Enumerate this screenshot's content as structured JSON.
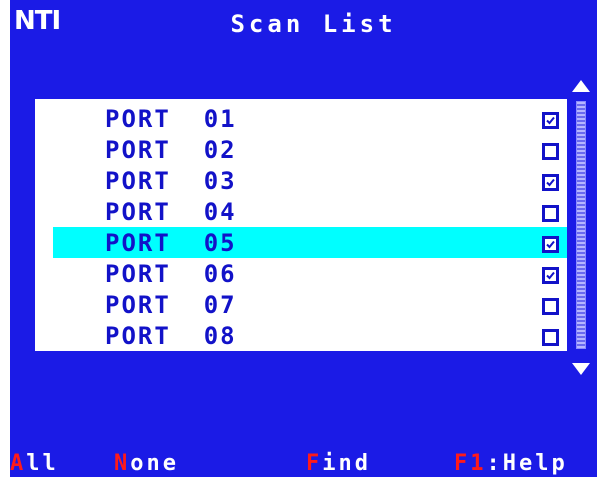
{
  "header": {
    "logo": "NTI",
    "title": "Scan List"
  },
  "scan_list": {
    "rows": [
      {
        "label": "PORT  01",
        "checked": true
      },
      {
        "label": "PORT  02",
        "checked": false
      },
      {
        "label": "PORT  03",
        "checked": true
      },
      {
        "label": "PORT  04",
        "checked": false
      },
      {
        "label": "PORT  05",
        "checked": true
      },
      {
        "label": "PORT  06",
        "checked": true
      },
      {
        "label": "PORT  07",
        "checked": false
      },
      {
        "label": "PORT  08",
        "checked": false
      }
    ],
    "selected_index": 4
  },
  "footer": {
    "all": {
      "hot": "A",
      "rest": "ll"
    },
    "none": {
      "hot": "N",
      "rest": "one"
    },
    "find": {
      "hot": "F",
      "rest": "ind"
    },
    "help": {
      "hot": "F1",
      "rest": ":Help"
    }
  },
  "colors": {
    "background": "#1b1be6",
    "text": "#1212c8",
    "highlight": "#00ffff",
    "hotkey": "#ff1a1a",
    "cursor": "#ff0000"
  }
}
